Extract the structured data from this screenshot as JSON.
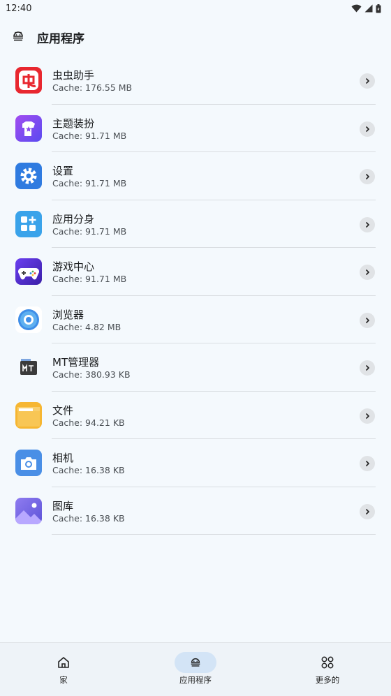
{
  "status_bar": {
    "time": "12:40"
  },
  "header": {
    "title": "应用程序"
  },
  "apps": [
    {
      "name": "虫虫助手",
      "cache": "Cache: 176.55 MB",
      "icon": "chongchong-icon"
    },
    {
      "name": "主题装扮",
      "cache": "Cache: 91.71 MB",
      "icon": "theme-icon"
    },
    {
      "name": "设置",
      "cache": "Cache: 91.71 MB",
      "icon": "settings-icon"
    },
    {
      "name": "应用分身",
      "cache": "Cache: 91.71 MB",
      "icon": "app-clone-icon"
    },
    {
      "name": "游戏中心",
      "cache": "Cache: 91.71 MB",
      "icon": "game-center-icon"
    },
    {
      "name": "浏览器",
      "cache": "Cache: 4.82 MB",
      "icon": "browser-icon"
    },
    {
      "name": "MT管理器",
      "cache": "Cache: 380.93 KB",
      "icon": "mt-manager-icon"
    },
    {
      "name": "文件",
      "cache": "Cache: 94.21 KB",
      "icon": "files-icon"
    },
    {
      "name": "相机",
      "cache": "Cache: 16.38 KB",
      "icon": "camera-icon"
    },
    {
      "name": "图库",
      "cache": "Cache: 16.38 KB",
      "icon": "gallery-icon"
    }
  ],
  "nav": {
    "home": "家",
    "apps": "应用程序",
    "more": "更多的"
  },
  "colors": {
    "accent": "#d3e4f6",
    "background": "#f4f9fd"
  }
}
